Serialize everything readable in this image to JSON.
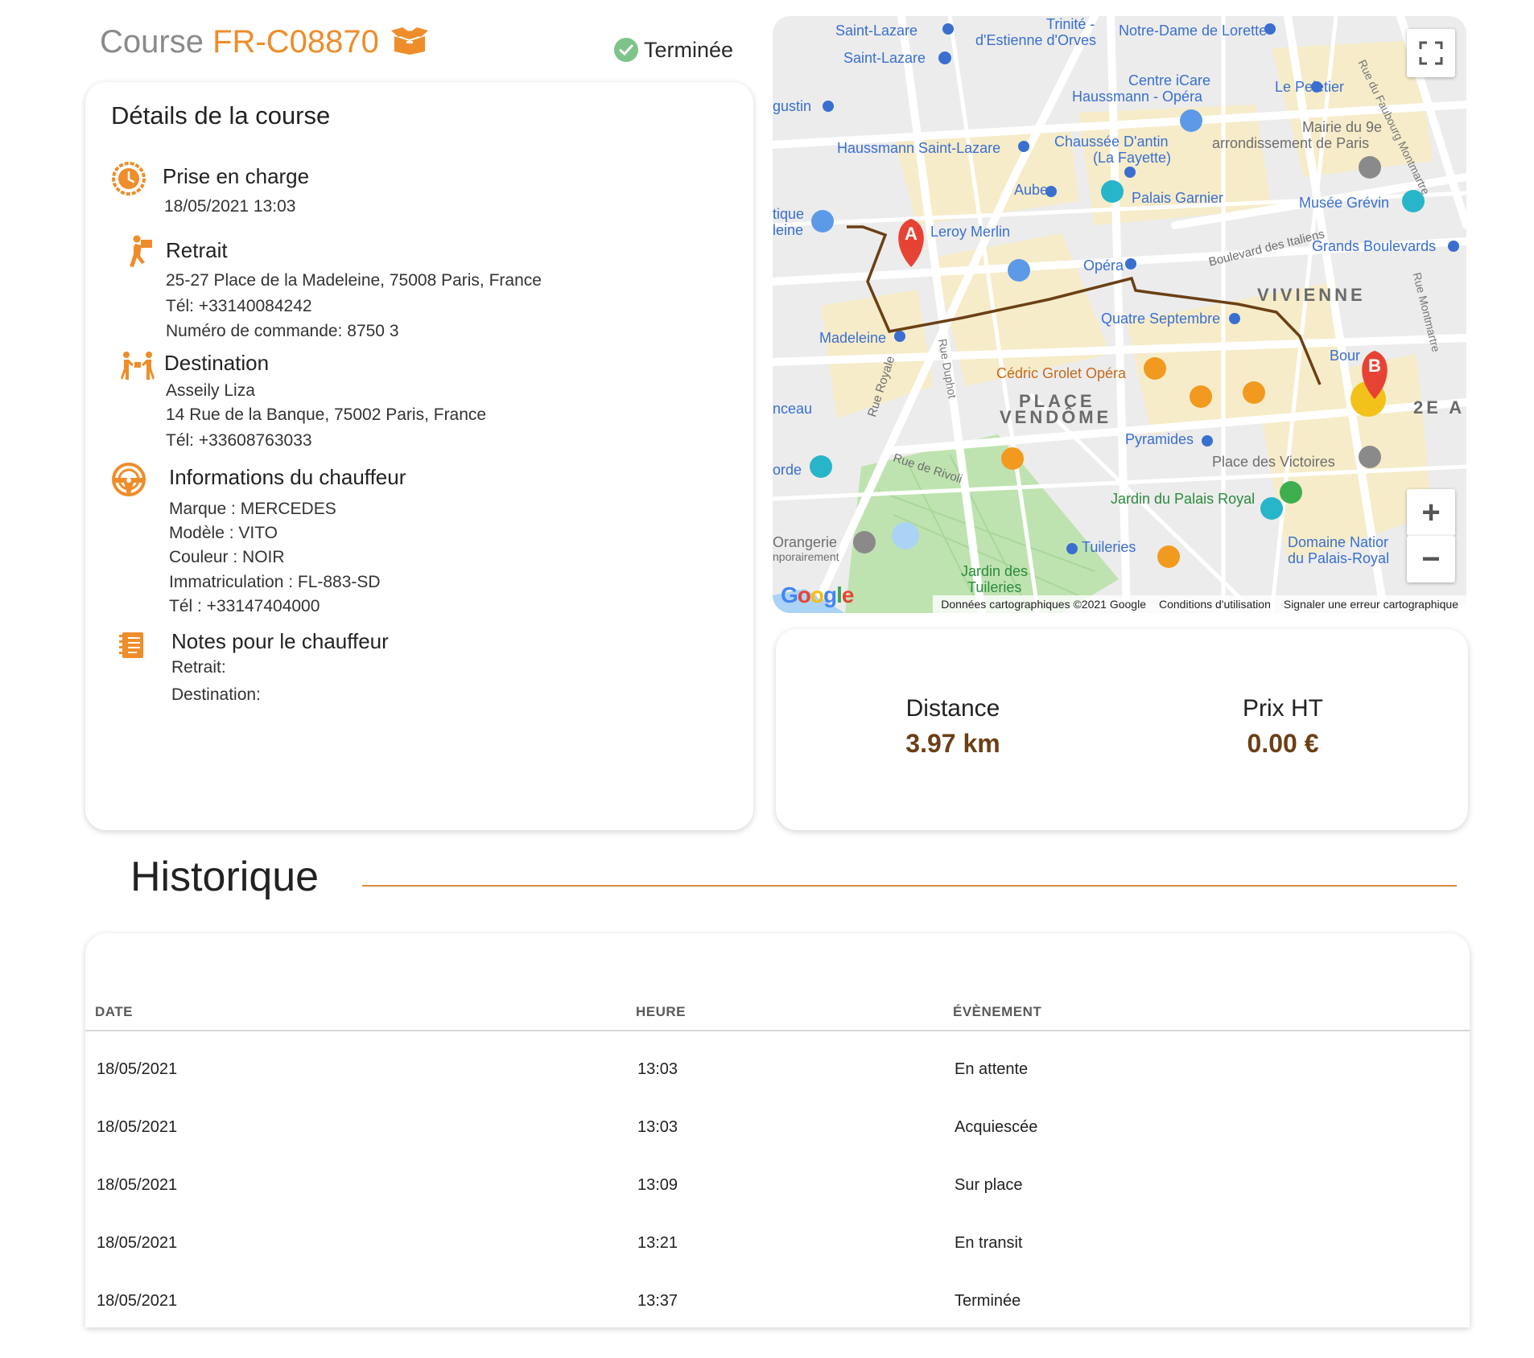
{
  "header": {
    "course_prefix": "Course",
    "course_ref": "FR-C08870",
    "status": "Terminée"
  },
  "details": {
    "title": "Détails de la course",
    "pickup": {
      "heading": "Prise en charge",
      "datetime": "18/05/2021 13:03"
    },
    "retrait": {
      "heading": "Retrait",
      "address": "25-27 Place de la Madeleine, 75008 Paris, France",
      "tel": "Tél: +33140084242",
      "order": "Numéro de commande: 8750 3"
    },
    "destination": {
      "heading": "Destination",
      "name": "Asseily Liza",
      "address": "14 Rue de la Banque, 75002 Paris, France",
      "tel": "Tél: +33608763033"
    },
    "driver": {
      "heading": "Informations du chauffeur",
      "brand": "Marque : MERCEDES",
      "model": "Modèle : VITO",
      "color": "Couleur : NOIR",
      "plate": "Immatriculation : FL-883-SD",
      "tel": "Tél : +33147404000"
    },
    "notes": {
      "heading": "Notes pour le chauffeur",
      "retrait": "Retrait:",
      "destination": "Destination:"
    }
  },
  "map": {
    "labels": {
      "saint_lazare_1": "Saint-Lazare",
      "saint_lazare_2": "Saint-Lazare",
      "trinite": "Trinité -",
      "estienne": "d'Estienne d'Orves",
      "notre_dame": "Notre-Dame de Lorette",
      "centre_icare_1": "Centre iCare",
      "centre_icare_2": "Haussmann - Opéra",
      "le_peletier": "Le Peletier",
      "mairie_1": "Mairie du 9e",
      "mairie_2": "arrondissement de Paris",
      "augustin": "gustin",
      "haussmann_sl": "Haussmann Saint-Lazare",
      "chaussee_1": "Chaussée D'antin",
      "chaussee_2": "(La Fayette)",
      "auber": "Auber",
      "palais_garnier": "Palais Garnier",
      "musee_grevin": "Musée Grévin",
      "tique": "tique",
      "leine": "leine",
      "leroy_merlin": "Leroy Merlin",
      "bd_italiens": "Boulevard des Italiens",
      "grands_boulevards": "Grands Boulevards",
      "opera": "Opéra",
      "vivienne": "VIVIENNE",
      "quatre_septembre": "Quatre Septembre",
      "madeleine": "Madeleine",
      "bourse": "Bour",
      "cedric_grolet": "Cédric Grolet Opéra",
      "place_vendome_1": "PLACE",
      "place_vendome_2": "VENDÔME",
      "nceau": "nceau",
      "deux_e": "2E A",
      "pyramides": "Pyramides",
      "place_victoires": "Place des Victoires",
      "orde": "orde",
      "rue_rivoli": "Rue de Rivoli",
      "jardin_palais_royal": "Jardin du Palais Royal",
      "rue_royale": "Rue Royale",
      "rue_duphot": "Rue Duphot",
      "orangerie_1": "Orangerie",
      "orangerie_2": "nporairement",
      "tuileries_station": "Tuileries",
      "jardin_tuileries_1": "Jardin des",
      "jardin_tuileries_2": "Tuileries",
      "domaine_1": "Domaine Natior",
      "domaine_2": "du Palais-Royal",
      "rue_faubourg": "Rue du Faubourg Montmartre",
      "rue_montmartre": "Rue Montmartre"
    },
    "marker_a": "A",
    "marker_b": "B",
    "google": [
      "G",
      "o",
      "o",
      "g",
      "l",
      "e"
    ],
    "attribution": {
      "data": "Données cartographiques ©2021 Google",
      "terms": "Conditions d'utilisation",
      "report": "Signaler une erreur cartographique"
    },
    "zoom_in": "+",
    "zoom_out": "−"
  },
  "stats": {
    "distance_label": "Distance",
    "distance_value": "3.97 km",
    "price_label": "Prix HT",
    "price_value": "0.00 €"
  },
  "history": {
    "title": "Historique",
    "columns": [
      "DATE",
      "HEURE",
      "ÉVÈNEMENT"
    ],
    "rows": [
      [
        "18/05/2021",
        "13:03",
        "En attente"
      ],
      [
        "18/05/2021",
        "13:03",
        "Acquiescée"
      ],
      [
        "18/05/2021",
        "13:09",
        "Sur place"
      ],
      [
        "18/05/2021",
        "13:21",
        "En transit"
      ],
      [
        "18/05/2021",
        "13:37",
        "Terminée"
      ]
    ]
  },
  "colors": {
    "accent": "#ee8d2a",
    "value_brown": "#6b3f15",
    "status_green": "#7cc48a",
    "route": "#6b3f15"
  }
}
